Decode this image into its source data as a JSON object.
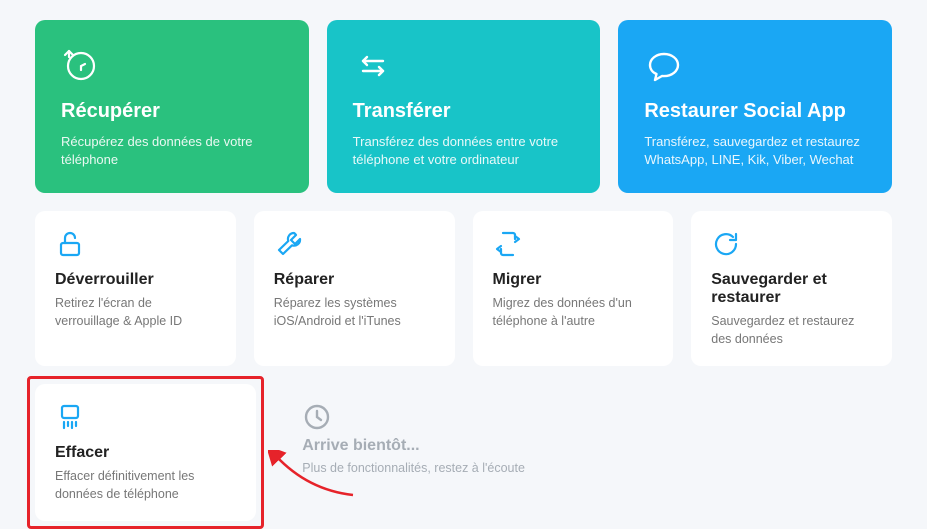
{
  "topCards": [
    {
      "title": "Récupérer",
      "desc": "Récupérez des données de votre téléphone"
    },
    {
      "title": "Transférer",
      "desc": "Transférez des données entre votre téléphone et votre ordinateur"
    },
    {
      "title": "Restaurer Social App",
      "desc": "Transférez, sauvegardez et restaurez WhatsApp, LINE, Kik, Viber, Wechat"
    }
  ],
  "midCards": [
    {
      "title": "Déverrouiller",
      "desc": "Retirez l'écran de verrouillage & Apple ID"
    },
    {
      "title": "Réparer",
      "desc": "Réparez les systèmes iOS/Android et l'iTunes"
    },
    {
      "title": "Migrer",
      "desc": "Migrez des données d'un téléphone à l'autre"
    },
    {
      "title": "Sauvegarder et restaurer",
      "desc": "Sauvegardez et restaurez des données"
    }
  ],
  "erase": {
    "title": "Effacer",
    "desc": "Effacer définitivement les données de téléphone"
  },
  "coming": {
    "title": "Arrive bientôt...",
    "desc": "Plus de fonctionnalités, restez à l'écoute"
  },
  "colors": {
    "accentBlue": "#1aa7f4",
    "green": "#2ac17e",
    "teal": "#18c4c8",
    "highlight": "#e6232a"
  }
}
